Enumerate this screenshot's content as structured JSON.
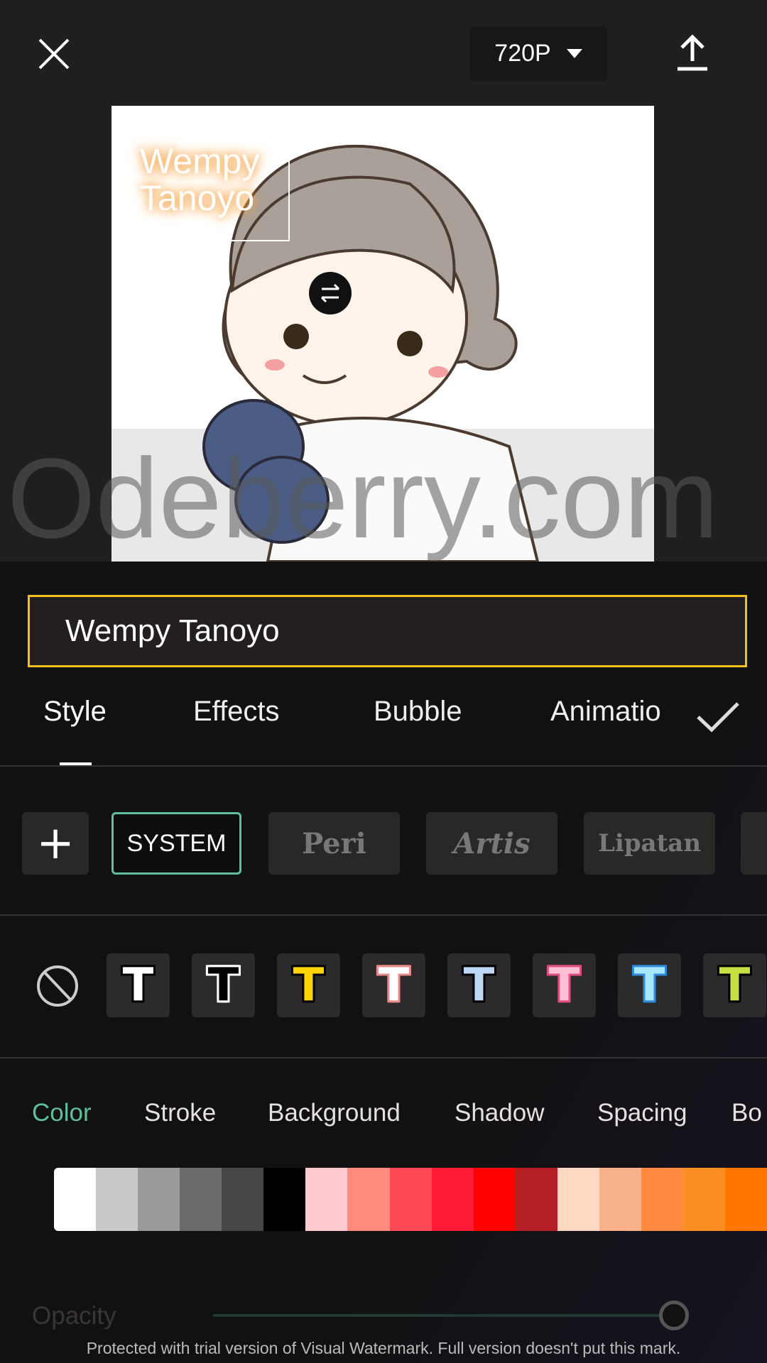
{
  "header": {
    "close_icon": "close-icon",
    "resolution": "720P",
    "export_icon": "upload-icon"
  },
  "preview": {
    "overlay_text_line1": "Wempy",
    "overlay_text_line2": "Tanoyo",
    "watermark": "Odeberry.com",
    "rotate_icon": "rotate-icon"
  },
  "text_input": {
    "value": "Wempy Tanoyo"
  },
  "tabs": [
    {
      "label": "Style",
      "active": true
    },
    {
      "label": "Effects"
    },
    {
      "label": "Bubble"
    },
    {
      "label": "Animatio"
    }
  ],
  "confirm_icon": "check-icon",
  "fonts": [
    {
      "label": "SYSTEM",
      "selected": true
    },
    {
      "label": "Peri"
    },
    {
      "label": "Artis"
    },
    {
      "label": "Lipatan"
    }
  ],
  "presets": [
    {
      "fill": "#ffffff",
      "stroke": "#000000"
    },
    {
      "fill": "#000000",
      "stroke": "#ffffff"
    },
    {
      "fill": "#ffd400",
      "stroke": "#000000"
    },
    {
      "fill": "#ffffff",
      "stroke": "#e88a8a"
    },
    {
      "fill": "#bcd8f5",
      "stroke": "#000000"
    },
    {
      "fill": "#ffc0d8",
      "stroke": "#e0507a"
    },
    {
      "fill": "#a8e8ff",
      "stroke": "#2f8ad8"
    },
    {
      "fill": "#c8e040",
      "stroke": "#000000"
    }
  ],
  "subtabs": [
    {
      "label": "Color",
      "active": true
    },
    {
      "label": "Stroke"
    },
    {
      "label": "Background"
    },
    {
      "label": "Shadow"
    },
    {
      "label": "Spacing"
    },
    {
      "label": "Bo"
    }
  ],
  "accent": "#5fbf9a",
  "palette": [
    "#ffffff",
    "#c9c9c9",
    "#9a9a9a",
    "#6b6b6b",
    "#464646",
    "#000000",
    "#ffcad0",
    "#ff8a7e",
    "#ff4a55",
    "#ff1a35",
    "#ff0000",
    "#b51e22",
    "#ffd8c4",
    "#f9b18a",
    "#ff8a40",
    "#fa8e22",
    "#ff7600"
  ],
  "opacity": {
    "label": "Opacity",
    "value": 100
  },
  "footer_watermark": "Protected with trial version of Visual Watermark. Full version doesn't put this mark."
}
